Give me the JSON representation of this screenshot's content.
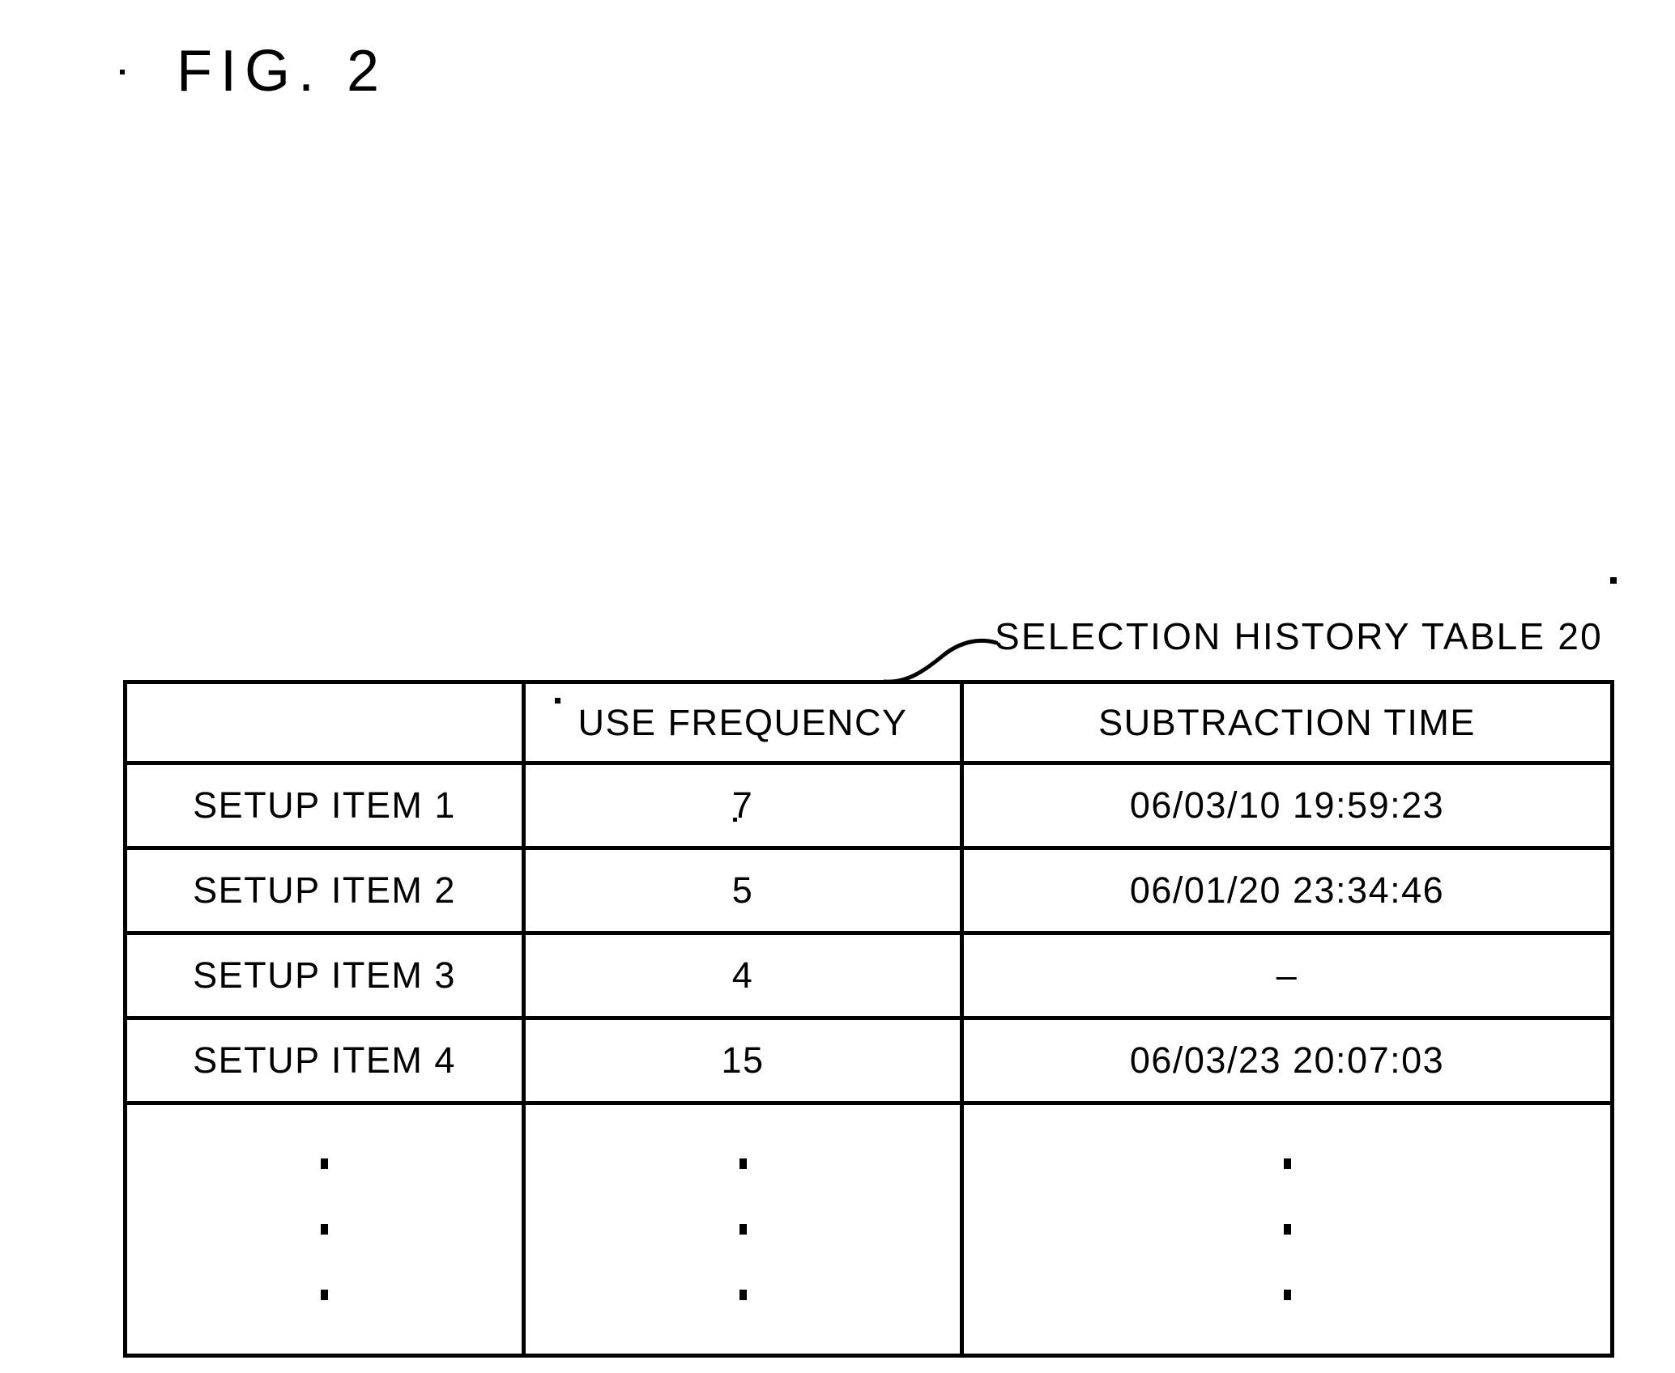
{
  "figure": {
    "title": "FIG.  2"
  },
  "callout": {
    "label": "SELECTION HISTORY TABLE 20",
    "leader_icon": "curved-leader-line"
  },
  "table": {
    "columns": [
      {
        "key": "item",
        "header": ""
      },
      {
        "key": "frequency",
        "header": "USE FREQUENCY"
      },
      {
        "key": "subtraction",
        "header": "SUBTRACTION TIME"
      }
    ],
    "rows": [
      {
        "item": "SETUP ITEM 1",
        "frequency": "7",
        "subtraction": "06/03/10 19:59:23"
      },
      {
        "item": "SETUP ITEM 2",
        "frequency": "5",
        "subtraction": "06/01/20 23:34:46"
      },
      {
        "item": "SETUP ITEM 3",
        "frequency": "4",
        "subtraction": "–"
      },
      {
        "item": "SETUP ITEM 4",
        "frequency": "15",
        "subtraction": "06/03/23 20:07:03"
      }
    ],
    "continuation": {
      "marker": "vertical-ellipsis",
      "dots": 3
    }
  },
  "colors": {
    "ink": "#000000",
    "paper": "#ffffff"
  }
}
